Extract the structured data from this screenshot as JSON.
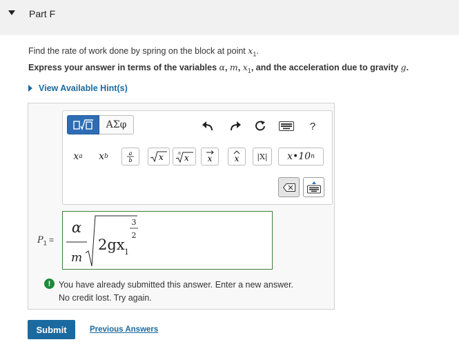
{
  "part": {
    "title": "Part F"
  },
  "question": {
    "text_before": "Find the rate of work done by spring on the block at point ",
    "var": "x",
    "var_sub": "1",
    "text_after": "."
  },
  "instruction": {
    "prefix": "Express your answer in terms of the variables ",
    "v1": "α",
    "sep1": ", ",
    "v2": "m",
    "sep2": ", ",
    "v3": "x",
    "v3_sub": "1",
    "middle": ", and the acceleration due to gravity ",
    "v4": "g",
    "suffix": "."
  },
  "hint": {
    "label": "View Available Hint(s)"
  },
  "toolbar": {
    "greek_label": "ΑΣφ",
    "help_label": "?",
    "sci_label": "x•10",
    "sci_sup": "n",
    "abs_label": "|X|"
  },
  "answer": {
    "lhs_var": "P",
    "lhs_sub": "1",
    "equals": "=",
    "numerator": "α",
    "denominator": "m",
    "radicand": "2gx",
    "radicand_sub": "1",
    "exp_num": "3",
    "exp_den": "2"
  },
  "feedback": {
    "icon": "!",
    "line1": "You have already submitted this answer. Enter a new answer.",
    "line2": "No credit lost. Try again."
  },
  "submit_label": "Submit",
  "previous_answers_label": "Previous Answers",
  "colors": {
    "link": "#1a6aa0",
    "submit": "#1a6aa0",
    "success": "#1e8a3a",
    "input_border": "#3a7d3a"
  }
}
